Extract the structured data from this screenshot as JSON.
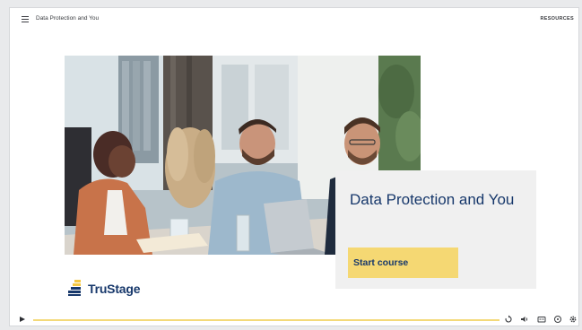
{
  "app": {
    "course_title": "Data Protection and You",
    "resources_label": "RESOURCES"
  },
  "card": {
    "title": "Data Protection and You",
    "start_label": "Start course"
  },
  "logo": {
    "text": "TruStage"
  },
  "player": {
    "progress_fraction": 0.0,
    "controls": [
      "play-icon",
      "replay-icon",
      "volume-icon",
      "captions-icon",
      "playback-rate-icon",
      "settings-icon"
    ]
  },
  "colors": {
    "brand_navy": "#17386b",
    "accent_yellow": "#f5d873",
    "card_bg": "#f0f0f0"
  }
}
